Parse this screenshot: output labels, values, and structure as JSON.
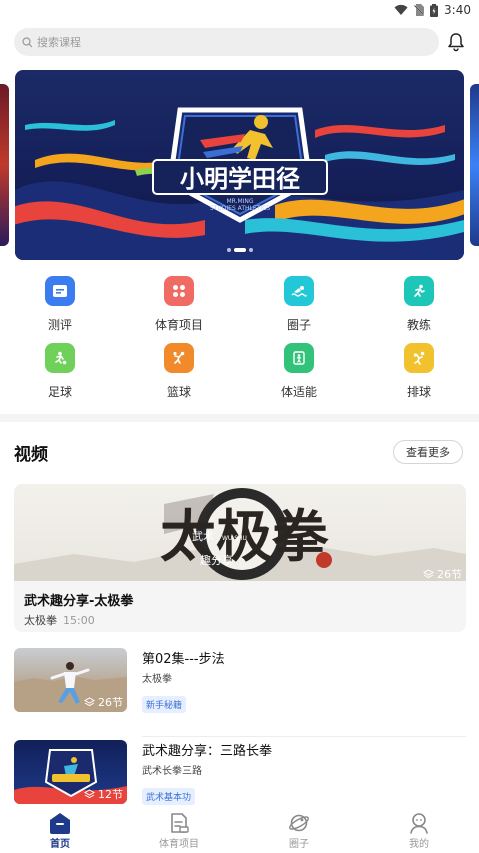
{
  "status_bar": {
    "time": "3:40"
  },
  "search": {
    "placeholder": "搜索课程"
  },
  "banner": {
    "title": "小明学田径",
    "subtitle_line1": "MR.MING",
    "subtitle_line2": "STUDIES ATHLETICS",
    "page_count": 3,
    "active_page": 2
  },
  "categories": [
    {
      "label": "测评",
      "icon": "clipboard-icon",
      "color": "#3b7cf0"
    },
    {
      "label": "体育项目",
      "icon": "grid-icon",
      "color": "#f06b63"
    },
    {
      "label": "圈子",
      "icon": "swimming-icon",
      "color": "#22c7d8"
    },
    {
      "label": "教练",
      "icon": "runner-icon",
      "color": "#1ec6b8"
    },
    {
      "label": "足球",
      "icon": "football-icon",
      "color": "#6fd15a"
    },
    {
      "label": "篮球",
      "icon": "basketball-icon",
      "color": "#f08a2a"
    },
    {
      "label": "体适能",
      "icon": "fitness-icon",
      "color": "#33c27a"
    },
    {
      "label": "排球",
      "icon": "volleyball-icon",
      "color": "#f2c12e"
    }
  ],
  "videos_section": {
    "title": "视频",
    "more_label": "查看更多"
  },
  "featured_video": {
    "thumb_text": "太极拳",
    "thumb_small_1": "武术",
    "thumb_small_2": "WU SHU",
    "thumb_small_3": "趣分享",
    "count": "26节",
    "title": "武术趣分享-太极拳",
    "subtitle": "太极拳",
    "duration": "15:00"
  },
  "video_list": [
    {
      "title": "第02集---步法",
      "subtitle": "太极拳",
      "tag": "新手秘籍",
      "count": "26节"
    },
    {
      "title": "武术趣分享：三路长拳",
      "subtitle": "武术长拳三路",
      "tag": "武术基本功",
      "count": "12节"
    }
  ],
  "tabs": [
    {
      "label": "首页",
      "icon": "home-icon",
      "active": true
    },
    {
      "label": "体育项目",
      "icon": "document-icon",
      "active": false
    },
    {
      "label": "圈子",
      "icon": "planet-icon",
      "active": false
    },
    {
      "label": "我的",
      "icon": "person-icon",
      "active": false
    }
  ],
  "colors": {
    "accent": "#1f3a8a",
    "tag_text": "#3b6fd6",
    "tag_bg": "#e6efff"
  }
}
